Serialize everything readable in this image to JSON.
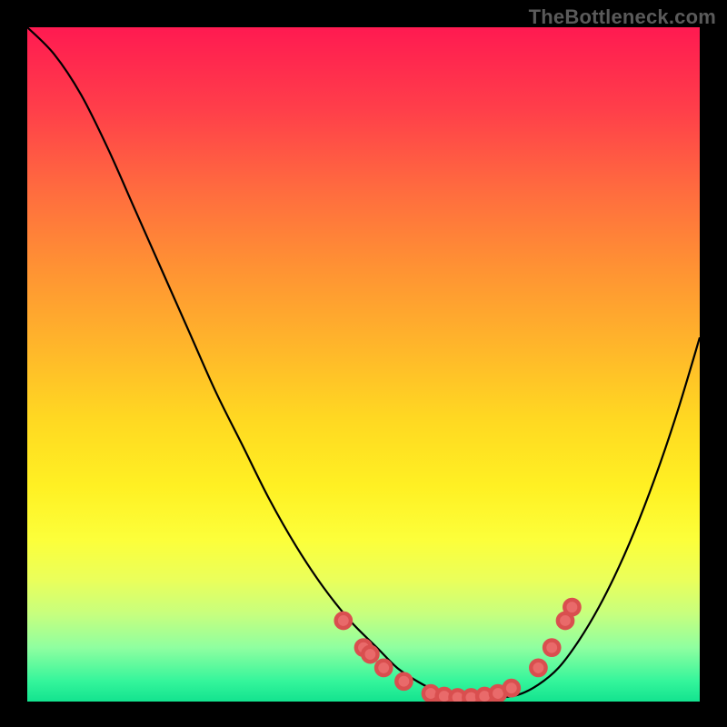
{
  "watermark": "TheBottleneck.com",
  "colors": {
    "background": "#000000",
    "curve": "#000000",
    "dot_fill": "#e96a6a",
    "gradient_top": "#ff1a51",
    "gradient_bottom": "#13e38f"
  },
  "chart_data": {
    "type": "line",
    "title": "",
    "xlabel": "",
    "ylabel": "",
    "xlim": [
      0,
      100
    ],
    "ylim": [
      0,
      100
    ],
    "grid": false,
    "legend": false,
    "annotations": [],
    "x": [
      0,
      4,
      8,
      12,
      16,
      20,
      24,
      28,
      32,
      36,
      40,
      44,
      48,
      52,
      55,
      58,
      61,
      64,
      67,
      70,
      73,
      76,
      79,
      82,
      85,
      88,
      91,
      94,
      97,
      100
    ],
    "y": [
      100,
      96,
      90,
      82,
      73,
      64,
      55,
      46,
      38,
      30,
      23,
      17,
      12,
      8,
      5,
      3,
      1.5,
      0.8,
      0.5,
      0.6,
      1,
      2.5,
      5,
      9,
      14,
      20,
      27,
      35,
      44,
      54
    ],
    "markers": {
      "x": [
        47,
        50,
        51,
        53,
        56,
        60,
        62,
        64,
        66,
        68,
        70,
        72,
        76,
        78,
        80,
        81
      ],
      "y": [
        12,
        8,
        7,
        5,
        3,
        1.2,
        0.8,
        0.6,
        0.6,
        0.8,
        1.2,
        2,
        5,
        8,
        12,
        14
      ]
    }
  }
}
